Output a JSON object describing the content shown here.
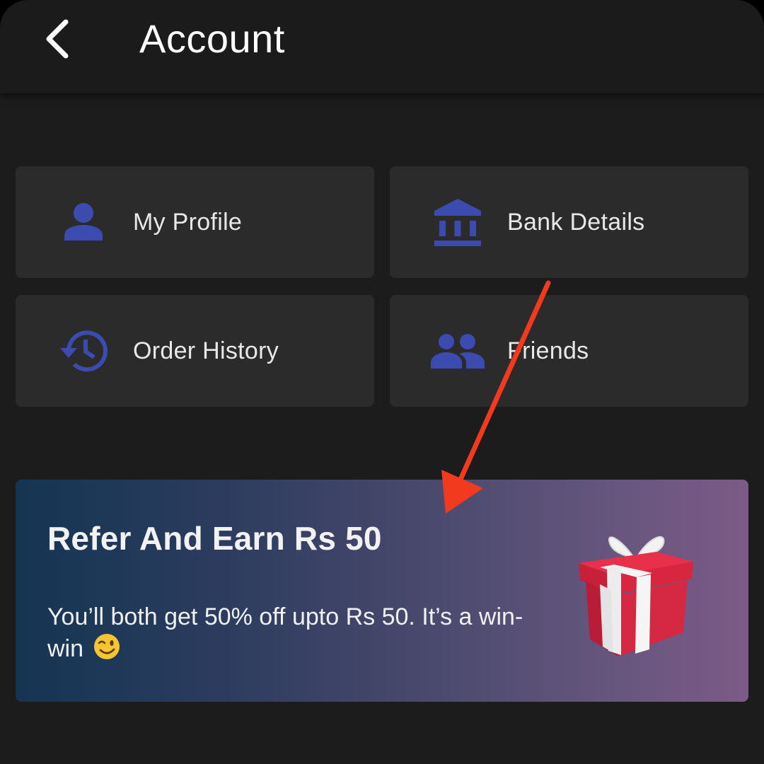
{
  "header": {
    "title": "Account",
    "back_icon": "chevron-left-icon"
  },
  "tiles": [
    {
      "label": "My Profile",
      "icon": "person-icon"
    },
    {
      "label": "Bank Details",
      "icon": "bank-icon"
    },
    {
      "label": "Order History",
      "icon": "history-icon"
    },
    {
      "label": "Friends",
      "icon": "people-icon"
    }
  ],
  "refer": {
    "title": "Refer And Earn Rs 50",
    "description": "You’ll both get 50% off upto Rs 50. It’s a win-win",
    "emoji_icon": "wink-emoji-icon",
    "image_icon": "gift-box-icon"
  },
  "colors": {
    "background": "#1c1c1c",
    "tile": "#2b2b2b",
    "icon_accent": "#3b4bb0",
    "annotation_arrow": "#f23a1e"
  }
}
